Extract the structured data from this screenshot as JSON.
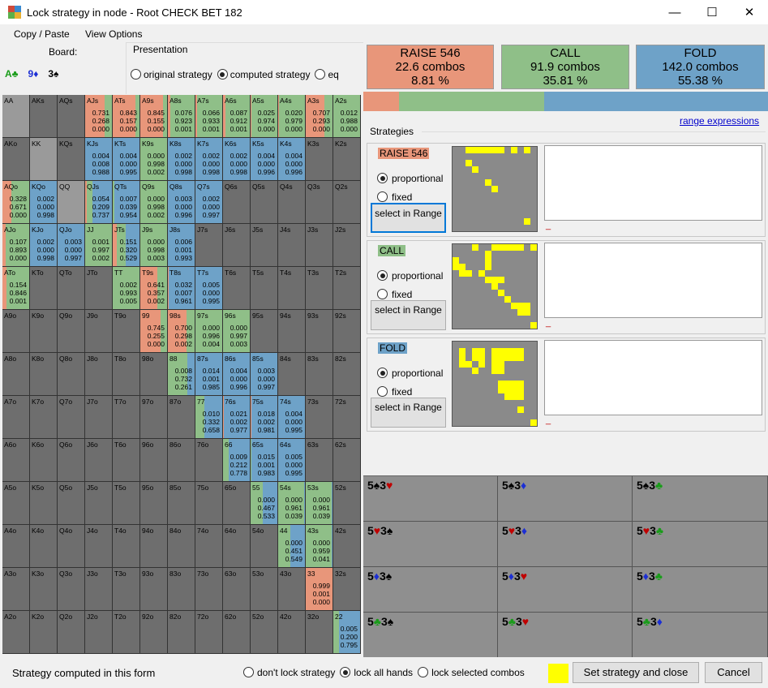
{
  "window": {
    "title": "Lock strategy in node  - Root CHECK BET 182",
    "minimize": "—",
    "maximize": "☐",
    "close": "✕"
  },
  "menu": {
    "copy_paste": "Copy / Paste",
    "view_options": "View Options"
  },
  "board": {
    "label": "Board:",
    "cards": [
      {
        "rank": "A",
        "suit": "♣",
        "color": "#1a9c1a"
      },
      {
        "rank": "9",
        "suit": "♦",
        "color": "#1c2fd4"
      },
      {
        "rank": "3",
        "suit": "♠",
        "color": "#000000"
      }
    ]
  },
  "presentation": {
    "title": "Presentation",
    "options": [
      {
        "label": "original strategy",
        "selected": false
      },
      {
        "label": "computed strategy",
        "selected": true
      },
      {
        "label": "eq",
        "selected": false
      }
    ]
  },
  "colors": {
    "raise": "#e8967a",
    "call": "#8fbf88",
    "fold": "#6ea2c8",
    "empty": "#6e6e6e",
    "pair": "#9a9a9a"
  },
  "actions": [
    {
      "name": "RAISE 546",
      "combos": "22.6 combos",
      "pct": "8.81 %",
      "share": 8.81
    },
    {
      "name": "CALL",
      "combos": "91.9 combos",
      "pct": "35.81 %",
      "share": 35.81
    },
    {
      "name": "FOLD",
      "combos": "142.0 combos",
      "pct": "55.38 %",
      "share": 55.38
    }
  ],
  "range_expressions": "range expressions",
  "strategies_label": "Strategies",
  "strategy_panels": [
    {
      "tag": "RAISE 546",
      "proportional": "proportional",
      "fixed": "fixed",
      "select": "select in Range",
      "mark": "_"
    },
    {
      "tag": "CALL",
      "proportional": "proportional",
      "fixed": "fixed",
      "select": "select in Range",
      "mark": "_"
    },
    {
      "tag": "FOLD",
      "proportional": "proportional",
      "fixed": "fixed",
      "select": "select in Range",
      "mark": "_"
    }
  ],
  "hand_grid": [
    [
      {
        "h": "AA"
      },
      {
        "h": "AKs"
      },
      {
        "h": "AQs"
      },
      {
        "h": "AJs",
        "v": [
          "0.731",
          "0.268",
          "0.000"
        ]
      },
      {
        "h": "ATs",
        "v": [
          "0.843",
          "0.157",
          "0.000"
        ]
      },
      {
        "h": "A9s",
        "v": [
          "0.845",
          "0.155",
          "0.000"
        ]
      },
      {
        "h": "A8s",
        "v": [
          "0.076",
          "0.923",
          "0.001"
        ]
      },
      {
        "h": "A7s",
        "v": [
          "0.066",
          "0.933",
          "0.001"
        ]
      },
      {
        "h": "A6s",
        "v": [
          "0.087",
          "0.912",
          "0.001"
        ]
      },
      {
        "h": "A5s",
        "v": [
          "0.025",
          "0.974",
          "0.000"
        ]
      },
      {
        "h": "A4s",
        "v": [
          "0.020",
          "0.979",
          "0.000"
        ]
      },
      {
        "h": "A3s",
        "v": [
          "0.707",
          "0.293",
          "0.000"
        ]
      },
      {
        "h": "A2s",
        "v": [
          "0.012",
          "0.988",
          "0.000"
        ]
      }
    ],
    [
      {
        "h": "AKo"
      },
      {
        "h": "KK"
      },
      {
        "h": "KQs"
      },
      {
        "h": "KJs",
        "v": [
          "0.004",
          "0.008",
          "0.988"
        ]
      },
      {
        "h": "KTs",
        "v": [
          "0.004",
          "0.000",
          "0.995"
        ]
      },
      {
        "h": "K9s",
        "v": [
          "0.000",
          "0.998",
          "0.002"
        ]
      },
      {
        "h": "K8s",
        "v": [
          "0.002",
          "0.000",
          "0.998"
        ]
      },
      {
        "h": "K7s",
        "v": [
          "0.002",
          "0.000",
          "0.998"
        ]
      },
      {
        "h": "K6s",
        "v": [
          "0.002",
          "0.000",
          "0.998"
        ]
      },
      {
        "h": "K5s",
        "v": [
          "0.004",
          "0.000",
          "0.996"
        ]
      },
      {
        "h": "K4s",
        "v": [
          "0.004",
          "0.000",
          "0.996"
        ]
      },
      {
        "h": "K3s"
      },
      {
        "h": "K2s"
      }
    ],
    [
      {
        "h": "AQo",
        "v": [
          "0.328",
          "0.671",
          "0.000"
        ]
      },
      {
        "h": "KQo",
        "v": [
          "0.002",
          "0.000",
          "0.998"
        ]
      },
      {
        "h": "QQ"
      },
      {
        "h": "QJs",
        "v": [
          "0.054",
          "0.209",
          "0.737"
        ]
      },
      {
        "h": "QTs",
        "v": [
          "0.007",
          "0.039",
          "0.954"
        ]
      },
      {
        "h": "Q9s",
        "v": [
          "0.000",
          "0.998",
          "0.002"
        ]
      },
      {
        "h": "Q8s",
        "v": [
          "0.003",
          "0.000",
          "0.996"
        ]
      },
      {
        "h": "Q7s",
        "v": [
          "0.002",
          "0.000",
          "0.997"
        ]
      },
      {
        "h": "Q6s"
      },
      {
        "h": "Q5s"
      },
      {
        "h": "Q4s"
      },
      {
        "h": "Q3s"
      },
      {
        "h": "Q2s"
      }
    ],
    [
      {
        "h": "AJo",
        "v": [
          "0.107",
          "0.893",
          "0.000"
        ]
      },
      {
        "h": "KJo",
        "v": [
          "0.002",
          "0.000",
          "0.998"
        ]
      },
      {
        "h": "QJo",
        "v": [
          "0.003",
          "0.000",
          "0.997"
        ]
      },
      {
        "h": "JJ",
        "v": [
          "0.001",
          "0.997",
          "0.002"
        ]
      },
      {
        "h": "JTs",
        "v": [
          "0.151",
          "0.320",
          "0.529"
        ]
      },
      {
        "h": "J9s",
        "v": [
          "0.000",
          "0.998",
          "0.003"
        ]
      },
      {
        "h": "J8s",
        "v": [
          "0.006",
          "0.001",
          "0.993"
        ]
      },
      {
        "h": "J7s"
      },
      {
        "h": "J6s"
      },
      {
        "h": "J5s"
      },
      {
        "h": "J4s"
      },
      {
        "h": "J3s"
      },
      {
        "h": "J2s"
      }
    ],
    [
      {
        "h": "ATo",
        "v": [
          "0.154",
          "0.846",
          "0.001"
        ]
      },
      {
        "h": "KTo"
      },
      {
        "h": "QTo"
      },
      {
        "h": "JTo"
      },
      {
        "h": "TT",
        "v": [
          "0.002",
          "0.993",
          "0.005"
        ]
      },
      {
        "h": "T9s",
        "v": [
          "0.641",
          "0.357",
          "0.002"
        ]
      },
      {
        "h": "T8s",
        "v": [
          "0.032",
          "0.007",
          "0.961"
        ]
      },
      {
        "h": "T7s",
        "v": [
          "0.005",
          "0.000",
          "0.995"
        ]
      },
      {
        "h": "T6s"
      },
      {
        "h": "T5s"
      },
      {
        "h": "T4s"
      },
      {
        "h": "T3s"
      },
      {
        "h": "T2s"
      }
    ],
    [
      {
        "h": "A9o"
      },
      {
        "h": "K9o"
      },
      {
        "h": "Q9o"
      },
      {
        "h": "J9o"
      },
      {
        "h": "T9o"
      },
      {
        "h": "99",
        "v": [
          "0.745",
          "0.255",
          "0.000"
        ]
      },
      {
        "h": "98s",
        "v": [
          "0.700",
          "0.298",
          "0.002"
        ]
      },
      {
        "h": "97s",
        "v": [
          "0.000",
          "0.996",
          "0.004"
        ]
      },
      {
        "h": "96s",
        "v": [
          "0.000",
          "0.997",
          "0.003"
        ]
      },
      {
        "h": "95s"
      },
      {
        "h": "94s"
      },
      {
        "h": "93s"
      },
      {
        "h": "92s"
      }
    ],
    [
      {
        "h": "A8o"
      },
      {
        "h": "K8o"
      },
      {
        "h": "Q8o"
      },
      {
        "h": "J8o"
      },
      {
        "h": "T8o"
      },
      {
        "h": "98o"
      },
      {
        "h": "88",
        "v": [
          "0.008",
          "0.732",
          "0.261"
        ]
      },
      {
        "h": "87s",
        "v": [
          "0.014",
          "0.001",
          "0.985"
        ]
      },
      {
        "h": "86s",
        "v": [
          "0.004",
          "0.000",
          "0.996"
        ]
      },
      {
        "h": "85s",
        "v": [
          "0.003",
          "0.000",
          "0.997"
        ]
      },
      {
        "h": "84s"
      },
      {
        "h": "83s"
      },
      {
        "h": "82s"
      }
    ],
    [
      {
        "h": "A7o"
      },
      {
        "h": "K7o"
      },
      {
        "h": "Q7o"
      },
      {
        "h": "J7o"
      },
      {
        "h": "T7o"
      },
      {
        "h": "97o"
      },
      {
        "h": "87o"
      },
      {
        "h": "77",
        "v": [
          "0.010",
          "0.332",
          "0.658"
        ]
      },
      {
        "h": "76s",
        "v": [
          "0.021",
          "0.002",
          "0.977"
        ]
      },
      {
        "h": "75s",
        "v": [
          "0.018",
          "0.002",
          "0.981"
        ]
      },
      {
        "h": "74s",
        "v": [
          "0.004",
          "0.000",
          "0.995"
        ]
      },
      {
        "h": "73s"
      },
      {
        "h": "72s"
      }
    ],
    [
      {
        "h": "A6o"
      },
      {
        "h": "K6o"
      },
      {
        "h": "Q6o"
      },
      {
        "h": "J6o"
      },
      {
        "h": "T6o"
      },
      {
        "h": "96o"
      },
      {
        "h": "86o"
      },
      {
        "h": "76o"
      },
      {
        "h": "66",
        "v": [
          "0.009",
          "0.212",
          "0.778"
        ]
      },
      {
        "h": "65s",
        "v": [
          "0.015",
          "0.001",
          "0.983"
        ]
      },
      {
        "h": "64s",
        "v": [
          "0.005",
          "0.000",
          "0.995"
        ]
      },
      {
        "h": "63s"
      },
      {
        "h": "62s"
      }
    ],
    [
      {
        "h": "A5o"
      },
      {
        "h": "K5o"
      },
      {
        "h": "Q5o"
      },
      {
        "h": "J5o"
      },
      {
        "h": "T5o"
      },
      {
        "h": "95o"
      },
      {
        "h": "85o"
      },
      {
        "h": "75o"
      },
      {
        "h": "65o"
      },
      {
        "h": "55",
        "v": [
          "0.000",
          "0.467",
          "0.533"
        ]
      },
      {
        "h": "54s",
        "v": [
          "0.000",
          "0.961",
          "0.039"
        ]
      },
      {
        "h": "53s",
        "v": [
          "0.000",
          "0.961",
          "0.039"
        ]
      },
      {
        "h": "52s"
      }
    ],
    [
      {
        "h": "A4o"
      },
      {
        "h": "K4o"
      },
      {
        "h": "Q4o"
      },
      {
        "h": "J4o"
      },
      {
        "h": "T4o"
      },
      {
        "h": "94o"
      },
      {
        "h": "84o"
      },
      {
        "h": "74o"
      },
      {
        "h": "64o"
      },
      {
        "h": "54o"
      },
      {
        "h": "44",
        "v": [
          "0.000",
          "0.451",
          "0.549"
        ]
      },
      {
        "h": "43s",
        "v": [
          "0.000",
          "0.959",
          "0.041"
        ]
      },
      {
        "h": "42s"
      }
    ],
    [
      {
        "h": "A3o"
      },
      {
        "h": "K3o"
      },
      {
        "h": "Q3o"
      },
      {
        "h": "J3o"
      },
      {
        "h": "T3o"
      },
      {
        "h": "93o"
      },
      {
        "h": "83o"
      },
      {
        "h": "73o"
      },
      {
        "h": "63o"
      },
      {
        "h": "53o"
      },
      {
        "h": "43o"
      },
      {
        "h": "33",
        "v": [
          "0.999",
          "0.001",
          "0.000"
        ]
      },
      {
        "h": "32s"
      }
    ],
    [
      {
        "h": "A2o"
      },
      {
        "h": "K2o"
      },
      {
        "h": "Q2o"
      },
      {
        "h": "J2o"
      },
      {
        "h": "T2o"
      },
      {
        "h": "92o"
      },
      {
        "h": "82o"
      },
      {
        "h": "72o"
      },
      {
        "h": "62o"
      },
      {
        "h": "52o"
      },
      {
        "h": "42o"
      },
      {
        "h": "32o"
      },
      {
        "h": "22",
        "v": [
          "0.005",
          "0.200",
          "0.795"
        ]
      }
    ]
  ],
  "combo_boards": [
    [
      {
        "r": "5",
        "s": "♠",
        "c": "#000000"
      },
      {
        "r": "3",
        "s": "♥",
        "c": "#c00000"
      }
    ],
    [
      {
        "r": "5",
        "s": "♠",
        "c": "#000000"
      },
      {
        "r": "3",
        "s": "♦",
        "c": "#1c2fd4"
      }
    ],
    [
      {
        "r": "5",
        "s": "♠",
        "c": "#000000"
      },
      {
        "r": "3",
        "s": "♣",
        "c": "#1a9c1a"
      }
    ],
    [
      {
        "r": "5",
        "s": "♥",
        "c": "#c00000"
      },
      {
        "r": "3",
        "s": "♠",
        "c": "#000000"
      }
    ],
    [
      {
        "r": "5",
        "s": "♥",
        "c": "#c00000"
      },
      {
        "r": "3",
        "s": "♦",
        "c": "#1c2fd4"
      }
    ],
    [
      {
        "r": "5",
        "s": "♥",
        "c": "#c00000"
      },
      {
        "r": "3",
        "s": "♣",
        "c": "#1a9c1a"
      }
    ],
    [
      {
        "r": "5",
        "s": "♦",
        "c": "#1c2fd4"
      },
      {
        "r": "3",
        "s": "♠",
        "c": "#000000"
      }
    ],
    [
      {
        "r": "5",
        "s": "♦",
        "c": "#1c2fd4"
      },
      {
        "r": "3",
        "s": "♥",
        "c": "#c00000"
      }
    ],
    [
      {
        "r": "5",
        "s": "♦",
        "c": "#1c2fd4"
      },
      {
        "r": "3",
        "s": "♣",
        "c": "#1a9c1a"
      }
    ],
    [
      {
        "r": "5",
        "s": "♣",
        "c": "#1a9c1a"
      },
      {
        "r": "3",
        "s": "♠",
        "c": "#000000"
      }
    ],
    [
      {
        "r": "5",
        "s": "♣",
        "c": "#1a9c1a"
      },
      {
        "r": "3",
        "s": "♥",
        "c": "#c00000"
      }
    ],
    [
      {
        "r": "5",
        "s": "♣",
        "c": "#1a9c1a"
      },
      {
        "r": "3",
        "s": "♦",
        "c": "#1c2fd4"
      }
    ]
  ],
  "footer": {
    "status": "Strategy computed in this form",
    "lock_options": [
      {
        "label": "don't lock strategy",
        "selected": false
      },
      {
        "label": "lock all hands",
        "selected": true
      },
      {
        "label": "lock selected combos",
        "selected": false
      }
    ],
    "set_strategy": "Set strategy and close",
    "cancel": "Cancel"
  }
}
